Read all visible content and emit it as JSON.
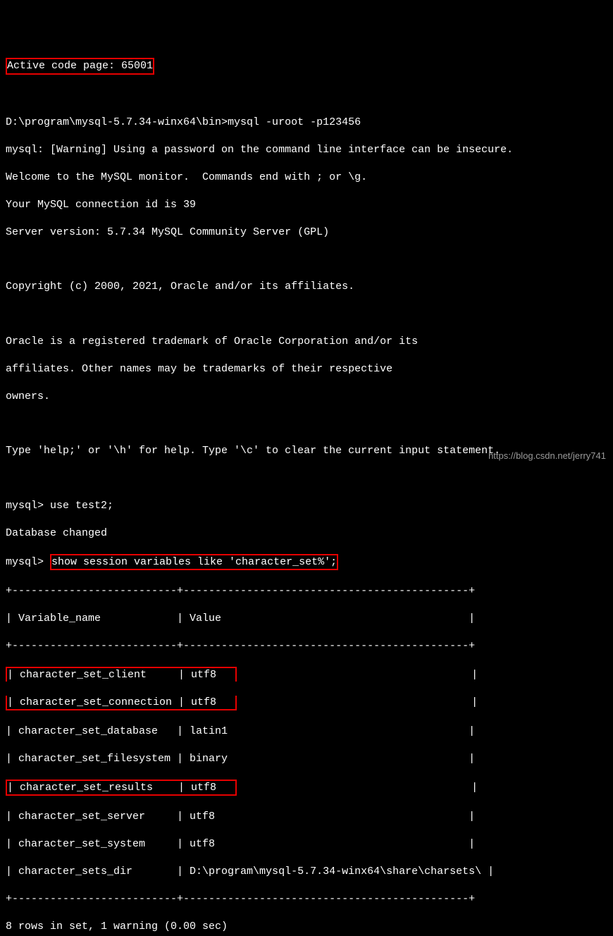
{
  "terminal": {
    "active_codepage": "Active code page: 65001",
    "path_cmd": "D:\\program\\mysql-5.7.34-winx64\\bin>mysql -uroot -p123456",
    "warning": "mysql: [Warning] Using a password on the command line interface can be insecure.",
    "welcome": "Welcome to the MySQL monitor.  Commands end with ; or \\g.",
    "conn_id": "Your MySQL connection id is 39",
    "server_ver": "Server version: 5.7.34 MySQL Community Server (GPL)",
    "copyright": "Copyright (c) 2000, 2021, Oracle and/or its affiliates.",
    "trademark1": "Oracle is a registered trademark of Oracle Corporation and/or its",
    "trademark2": "affiliates. Other names may be trademarks of their respective",
    "trademark3": "owners.",
    "help": "Type 'help;' or '\\h' for help. Type '\\c' to clear the current input statement.",
    "use_cmd": "mysql> use test2;",
    "db_changed": "Database changed",
    "show_prompt": "mysql> ",
    "show_cmd": "show session variables like 'character_set%';",
    "table": {
      "border_top": "+--------------------------+---------------------------------------------+",
      "header": "| Variable_name            | Value                                       |",
      "border_mid": "+--------------------------+---------------------------------------------+",
      "rows": [
        "| character_set_client     | utf8                                        |",
        "| character_set_connection | utf8                                        |",
        "| character_set_database   | latin1                                      |",
        "| character_set_filesystem | binary                                      |",
        "| character_set_results    | utf8                                        |",
        "| character_set_server     | utf8                                        |",
        "| character_set_system     | utf8                                        |",
        "| character_sets_dir       | D:\\program\\mysql-5.7.34-winx64\\share\\charsets\\ |"
      ],
      "border_bot": "+--------------------------+---------------------------------------------+",
      "summary": "8 rows in set, 1 warning (0.00 sec)",
      "client_row": "| character_set_client     | utf8   ",
      "connection_row": "| character_set_connection | utf8   ",
      "connection_tail": "                                     |",
      "results_row": "| character_set_results    | utf8   ",
      "results_tail": "                                     |"
    },
    "watermark": "https://blog.csdn.net/jerry741"
  }
}
